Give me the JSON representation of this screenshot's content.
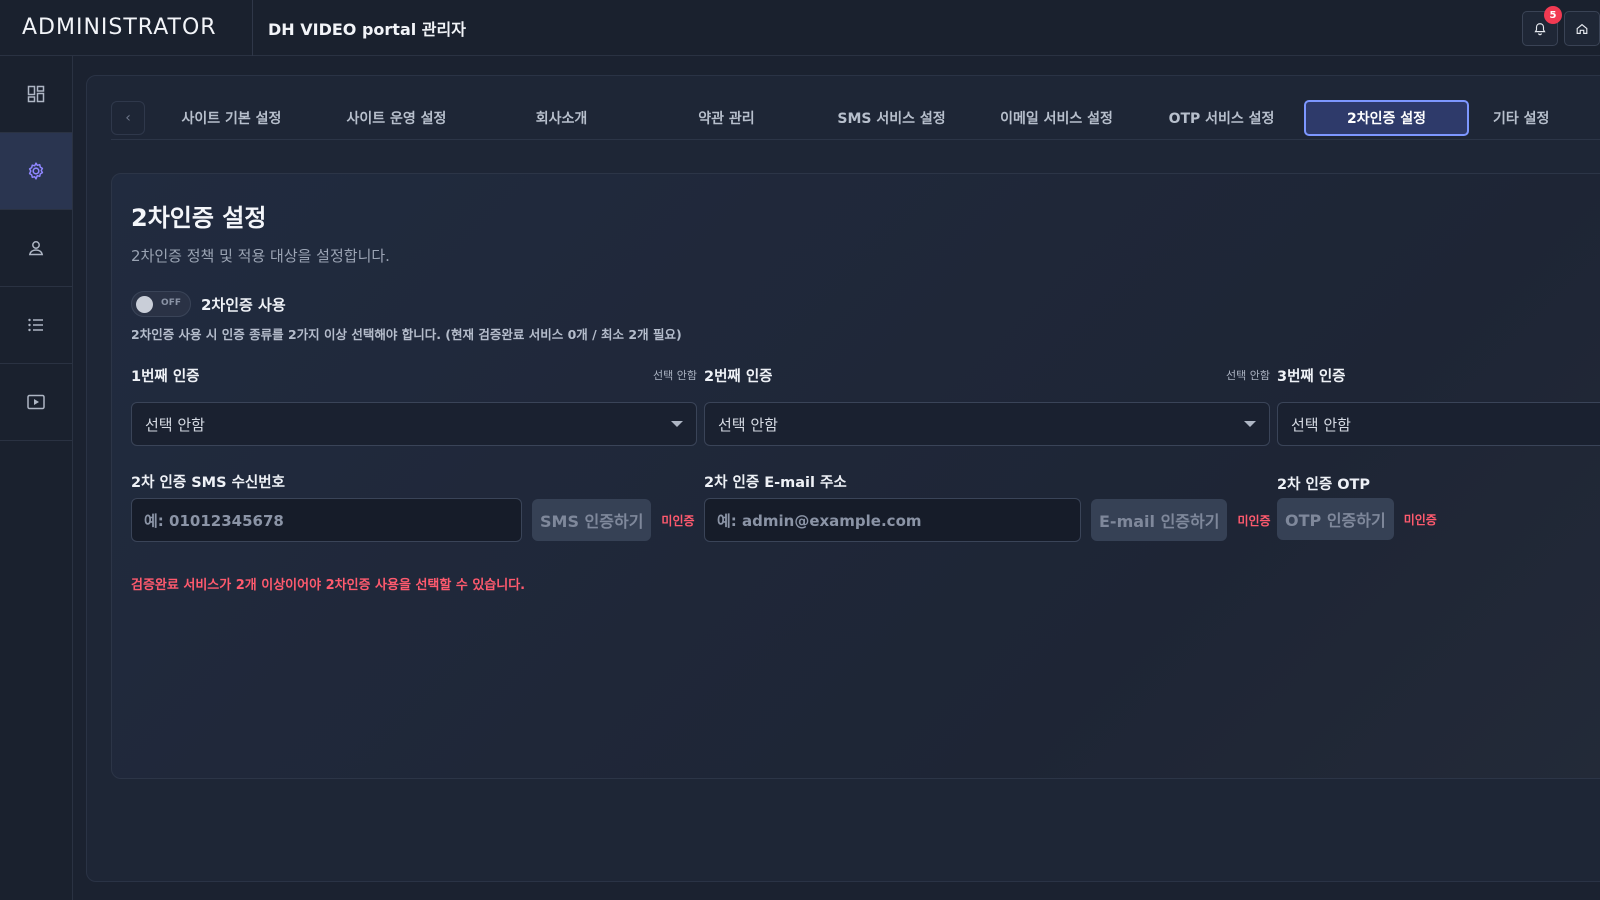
{
  "header": {
    "brand": "ADMINISTRATOR",
    "title": "DH VIDEO portal 관리자",
    "notification_count": "5"
  },
  "sidebar": {
    "items": [
      {
        "icon": "dashboard-icon",
        "active": false
      },
      {
        "icon": "gear-icon",
        "active": true
      },
      {
        "icon": "user-icon",
        "active": false
      },
      {
        "icon": "list-icon",
        "active": false
      },
      {
        "icon": "video-icon",
        "active": false
      }
    ]
  },
  "tabs": [
    {
      "label": "사이트 기본 설정"
    },
    {
      "label": "사이트 운영 설정"
    },
    {
      "label": "회사소개"
    },
    {
      "label": "약관 관리"
    },
    {
      "label": "SMS 서비스 설정"
    },
    {
      "label": "이메일 서비스 설정"
    },
    {
      "label": "OTP 서비스 설정"
    },
    {
      "label": "2차인증 설정",
      "active": true
    },
    {
      "label": "기타 설정"
    }
  ],
  "card": {
    "title": "2차인증 설정",
    "description": "2차인증 정책 및 적용 대상을 설정합니다.",
    "toggle_state": "OFF",
    "toggle_label": "2차인증 사용",
    "hint": "2차인증 사용 시 인증 종류를 2가지 이상 선택해야 합니다. (현재 검증완료 서비스 0개 / 최소 2개 필요)",
    "auth1": {
      "title": "1번째 인증",
      "side": "선택 안함",
      "value": "선택 안함"
    },
    "auth2": {
      "title": "2번째 인증",
      "side": "선택 안함",
      "value": "선택 안함"
    },
    "auth3": {
      "title": "3번째 인증",
      "value": "선택 안함"
    },
    "sms": {
      "label": "2차 인증 SMS 수신번호",
      "placeholder": "예: 01012345678",
      "button": "SMS 인증하기",
      "status": "미인증"
    },
    "email": {
      "label": "2차 인증 E-mail 주소",
      "placeholder": "예: admin@example.com",
      "button": "E-mail 인증하기",
      "status": "미인증"
    },
    "otp": {
      "label": "2차 인증 OTP",
      "button": "OTP 인증하기",
      "status": "미인증"
    },
    "error": "검증완료 서비스가 2개 이상이어야 2차인증 사용을 선택할 수 있습니다."
  },
  "colors": {
    "accent": "#7d97ff",
    "error": "#ff5a6e",
    "badge": "#f23a52"
  }
}
